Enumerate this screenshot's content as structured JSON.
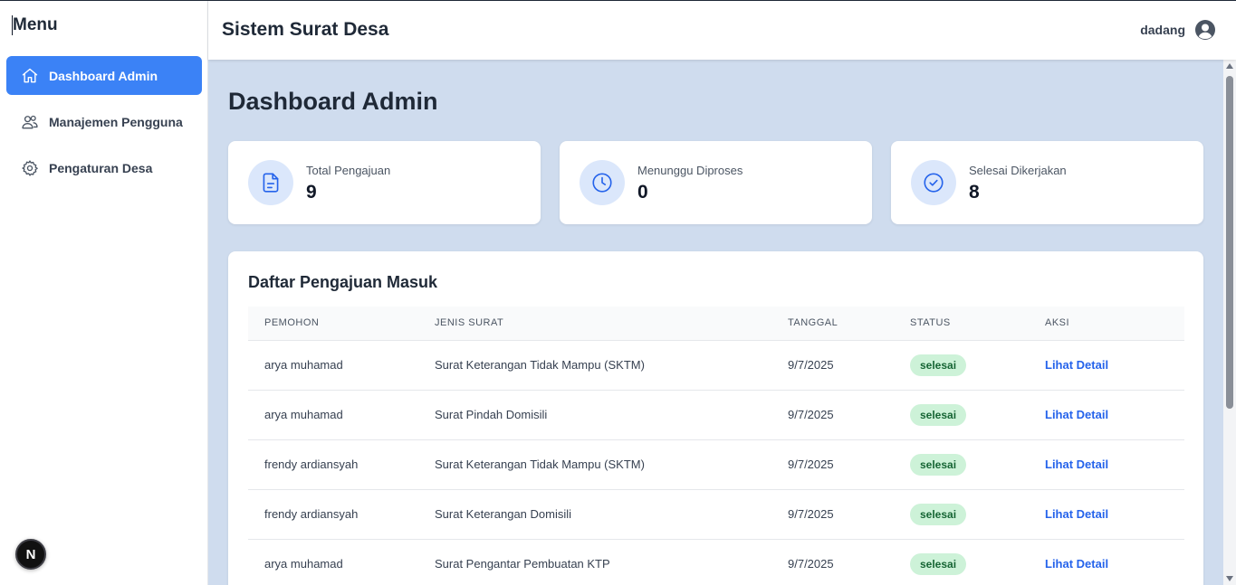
{
  "sidebar": {
    "title": "Menu",
    "items": [
      {
        "label": "Dashboard Admin",
        "icon": "home-icon",
        "active": true
      },
      {
        "label": "Manajemen Pengguna",
        "icon": "users-icon",
        "active": false
      },
      {
        "label": "Pengaturan Desa",
        "icon": "gear-icon",
        "active": false
      }
    ],
    "badge": "N"
  },
  "header": {
    "title": "Sistem Surat Desa",
    "username": "dadang",
    "avatar_icon": "user-circle-icon"
  },
  "main": {
    "page_title": "Dashboard Admin",
    "stats": [
      {
        "label": "Total Pengajuan",
        "value": "9",
        "icon": "document-icon"
      },
      {
        "label": "Menunggu Diproses",
        "value": "0",
        "icon": "clock-icon"
      },
      {
        "label": "Selesai Dikerjakan",
        "value": "8",
        "icon": "check-circle-icon"
      }
    ],
    "table": {
      "title": "Daftar Pengajuan Masuk",
      "headers": [
        "PEMOHON",
        "JENIS SURAT",
        "TANGGAL",
        "STATUS",
        "AKSI"
      ],
      "rows": [
        {
          "pemohon": "arya muhamad",
          "jenis": "Surat Keterangan Tidak Mampu (SKTM)",
          "tanggal": "9/7/2025",
          "status": "selesai",
          "aksi": "Lihat Detail"
        },
        {
          "pemohon": "arya muhamad",
          "jenis": "Surat Pindah Domisili",
          "tanggal": "9/7/2025",
          "status": "selesai",
          "aksi": "Lihat Detail"
        },
        {
          "pemohon": "frendy ardiansyah",
          "jenis": "Surat Keterangan Tidak Mampu (SKTM)",
          "tanggal": "9/7/2025",
          "status": "selesai",
          "aksi": "Lihat Detail"
        },
        {
          "pemohon": "frendy ardiansyah",
          "jenis": "Surat Keterangan Domisili",
          "tanggal": "9/7/2025",
          "status": "selesai",
          "aksi": "Lihat Detail"
        },
        {
          "pemohon": "arya muhamad",
          "jenis": "Surat Pengantar Pembuatan KTP",
          "tanggal": "9/7/2025",
          "status": "selesai",
          "aksi": "Lihat Detail"
        }
      ]
    }
  },
  "colors": {
    "accent": "#3b82f6",
    "main_bg": "#cfdcee",
    "status_bg": "#cdf2d8",
    "status_text": "#166534",
    "link": "#2563eb"
  }
}
